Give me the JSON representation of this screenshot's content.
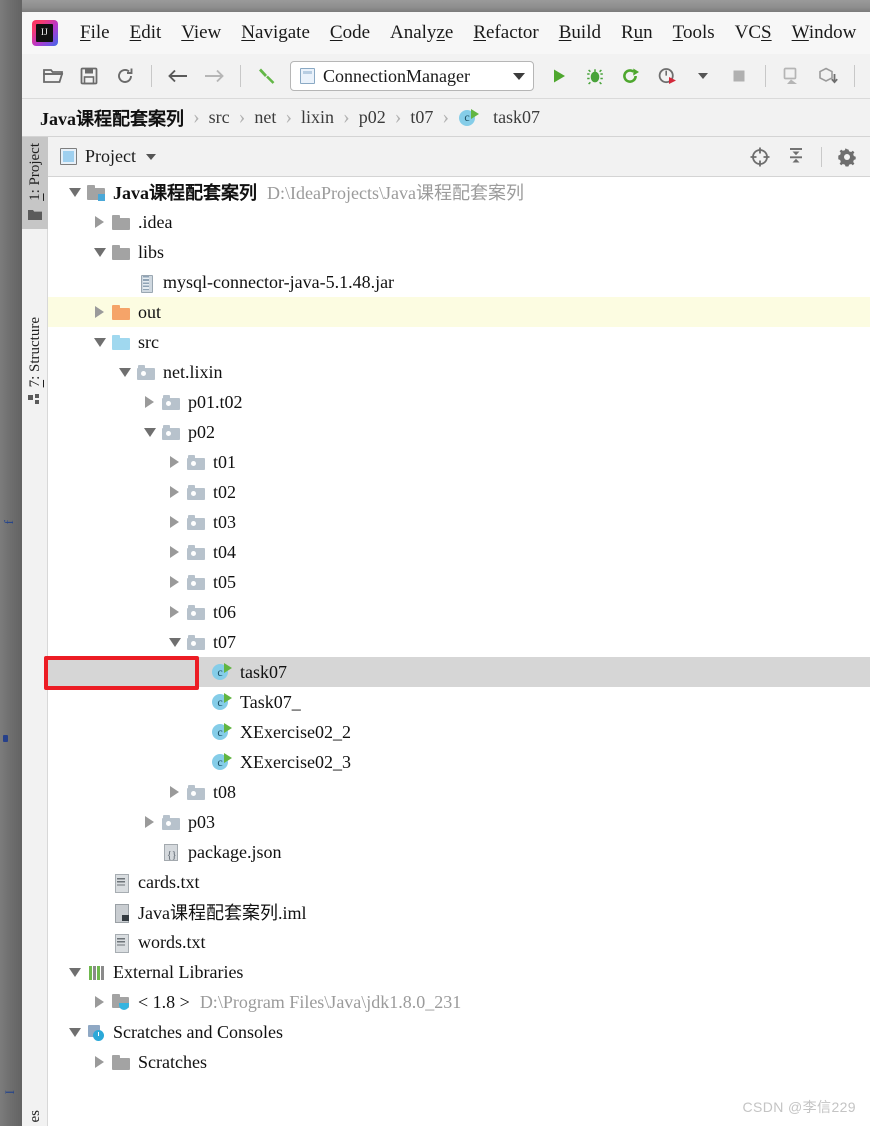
{
  "menu": {
    "items": [
      {
        "label": "File",
        "mnemonic": "F"
      },
      {
        "label": "Edit",
        "mnemonic": "E"
      },
      {
        "label": "View",
        "mnemonic": "V"
      },
      {
        "label": "Navigate",
        "mnemonic": "N"
      },
      {
        "label": "Code",
        "mnemonic": "C"
      },
      {
        "label": "Analyze",
        "mnemonic": "z"
      },
      {
        "label": "Refactor",
        "mnemonic": "R"
      },
      {
        "label": "Build",
        "mnemonic": "B"
      },
      {
        "label": "Run",
        "mnemonic": "u"
      },
      {
        "label": "Tools",
        "mnemonic": "T"
      },
      {
        "label": "VCS",
        "mnemonic": "S"
      },
      {
        "label": "Window",
        "mnemonic": "W"
      }
    ]
  },
  "toolbar": {
    "icons": [
      "open-folder-icon",
      "save-all-icon",
      "sync-refresh-icon",
      "navigate-back-icon",
      "navigate-forward-icon",
      "build-hammer-icon"
    ],
    "run_config": {
      "label": "ConnectionManager",
      "icon": "run-config-class-icon"
    },
    "run_icon": "run-triangle-icon",
    "debug_icon": "debug-bug-icon",
    "run_coverage_icon": "run-with-coverage-icon",
    "profile_icon": "profiler-icon",
    "stop_icon": "stop-square-icon",
    "right_icons": [
      "device-manager-icon",
      "gradle-sync-icon",
      "search-everywhere-icon"
    ]
  },
  "breadcrumb": {
    "items": [
      "Java课程配套案列",
      "src",
      "net",
      "lixin",
      "p02",
      "t07"
    ],
    "leaf": "task07",
    "leaf_icon": "java-class-icon",
    "separator": "›"
  },
  "tool_strip": {
    "tabs": [
      {
        "label": "1: Project",
        "mnemonic": "1",
        "icon": "project-folder-icon",
        "active": true
      },
      {
        "label": "7: Structure",
        "mnemonic": "7",
        "icon": "structure-blocks-icon",
        "active": false
      }
    ],
    "bottom_tab": {
      "label": "es",
      "icon": "favorites-icon"
    }
  },
  "panel": {
    "title": "Project",
    "title_icon": "project-view-icon",
    "dropdown_icon": "chevron-down-icon",
    "actions": [
      "locate-target-icon",
      "collapse-all-icon",
      "settings-gear-icon"
    ]
  },
  "tree": {
    "nodes": [
      {
        "label": "Java课程配套案列",
        "sub": "D:\\IdeaProjects\\Java课程配套案列",
        "depth": 0,
        "twisty": "open",
        "icon": "project-root-folder-icon",
        "bold": true,
        "state": "normal"
      },
      {
        "label": ".idea",
        "sub": "",
        "depth": 1,
        "twisty": "closed",
        "icon": "folder-gray-icon",
        "bold": false,
        "state": "normal"
      },
      {
        "label": "libs",
        "sub": "",
        "depth": 1,
        "twisty": "open",
        "icon": "folder-gray-icon",
        "bold": false,
        "state": "normal"
      },
      {
        "label": "mysql-connector-java-5.1.48.jar",
        "sub": "",
        "depth": 2,
        "twisty": "none",
        "icon": "jar-file-icon",
        "bold": false,
        "state": "normal"
      },
      {
        "label": "out",
        "sub": "",
        "depth": 1,
        "twisty": "closed",
        "icon": "folder-orange-icon",
        "bold": false,
        "state": "highlight"
      },
      {
        "label": "src",
        "sub": "",
        "depth": 1,
        "twisty": "open",
        "icon": "folder-blue-icon",
        "bold": false,
        "state": "normal"
      },
      {
        "label": "net.lixin",
        "sub": "",
        "depth": 2,
        "twisty": "open",
        "icon": "package-icon",
        "bold": false,
        "state": "normal"
      },
      {
        "label": "p01.t02",
        "sub": "",
        "depth": 3,
        "twisty": "closed",
        "icon": "package-icon",
        "bold": false,
        "state": "normal"
      },
      {
        "label": "p02",
        "sub": "",
        "depth": 3,
        "twisty": "open",
        "icon": "package-icon",
        "bold": false,
        "state": "normal"
      },
      {
        "label": "t01",
        "sub": "",
        "depth": 4,
        "twisty": "closed",
        "icon": "package-icon",
        "bold": false,
        "state": "normal"
      },
      {
        "label": "t02",
        "sub": "",
        "depth": 4,
        "twisty": "closed",
        "icon": "package-icon",
        "bold": false,
        "state": "normal"
      },
      {
        "label": "t03",
        "sub": "",
        "depth": 4,
        "twisty": "closed",
        "icon": "package-icon",
        "bold": false,
        "state": "normal"
      },
      {
        "label": "t04",
        "sub": "",
        "depth": 4,
        "twisty": "closed",
        "icon": "package-icon",
        "bold": false,
        "state": "normal"
      },
      {
        "label": "t05",
        "sub": "",
        "depth": 4,
        "twisty": "closed",
        "icon": "package-icon",
        "bold": false,
        "state": "normal"
      },
      {
        "label": "t06",
        "sub": "",
        "depth": 4,
        "twisty": "closed",
        "icon": "package-icon",
        "bold": false,
        "state": "normal"
      },
      {
        "label": "t07",
        "sub": "",
        "depth": 4,
        "twisty": "open",
        "icon": "package-icon",
        "bold": false,
        "state": "normal"
      },
      {
        "label": "task07",
        "sub": "",
        "depth": 5,
        "twisty": "none",
        "icon": "java-class-icon",
        "bold": false,
        "state": "selected"
      },
      {
        "label": "Task07_",
        "sub": "",
        "depth": 5,
        "twisty": "none",
        "icon": "java-class-icon",
        "bold": false,
        "state": "normal"
      },
      {
        "label": "XExercise02_2",
        "sub": "",
        "depth": 5,
        "twisty": "none",
        "icon": "java-class-icon",
        "bold": false,
        "state": "normal"
      },
      {
        "label": "XExercise02_3",
        "sub": "",
        "depth": 5,
        "twisty": "none",
        "icon": "java-class-icon",
        "bold": false,
        "state": "normal"
      },
      {
        "label": "t08",
        "sub": "",
        "depth": 4,
        "twisty": "closed",
        "icon": "package-icon",
        "bold": false,
        "state": "normal"
      },
      {
        "label": "p03",
        "sub": "",
        "depth": 3,
        "twisty": "closed",
        "icon": "package-icon",
        "bold": false,
        "state": "normal"
      },
      {
        "label": "package.json",
        "sub": "",
        "depth": 3,
        "twisty": "none",
        "icon": "json-file-icon",
        "bold": false,
        "state": "normal"
      },
      {
        "label": "cards.txt",
        "sub": "",
        "depth": 1,
        "twisty": "none",
        "icon": "text-file-icon",
        "bold": false,
        "state": "normal"
      },
      {
        "label": "Java课程配套案列.iml",
        "sub": "",
        "depth": 1,
        "twisty": "none",
        "icon": "iml-module-file-icon",
        "bold": false,
        "state": "normal"
      },
      {
        "label": "words.txt",
        "sub": "",
        "depth": 1,
        "twisty": "none",
        "icon": "text-file-icon",
        "bold": false,
        "state": "normal"
      },
      {
        "label": "External Libraries",
        "sub": "",
        "depth": 0,
        "twisty": "open",
        "icon": "external-libraries-icon",
        "bold": false,
        "state": "normal"
      },
      {
        "label": "< 1.8 >",
        "sub": "D:\\Program Files\\Java\\jdk1.8.0_231",
        "depth": 1,
        "twisty": "closed",
        "icon": "jdk-folder-icon",
        "bold": false,
        "state": "normal"
      },
      {
        "label": "Scratches and Consoles",
        "sub": "",
        "depth": 0,
        "twisty": "open",
        "icon": "scratches-icon",
        "bold": false,
        "state": "normal"
      },
      {
        "label": "Scratches",
        "sub": "",
        "depth": 1,
        "twisty": "closed",
        "icon": "folder-gray-icon",
        "bold": false,
        "state": "normal"
      }
    ]
  },
  "annotation": {
    "type": "red-rectangle",
    "color": "#ec1c24",
    "target": "task07"
  },
  "watermark": {
    "text": "CSDN @李信229"
  },
  "colors": {
    "selection": "#d6d6d6",
    "highlight_row": "#fcfce1",
    "panel_bg": "#ffffff",
    "chrome_bg": "#f2f2f2",
    "accent_green": "#62b542",
    "class_icon_blue": "#85cde8",
    "annotation_red": "#ec1c24"
  }
}
